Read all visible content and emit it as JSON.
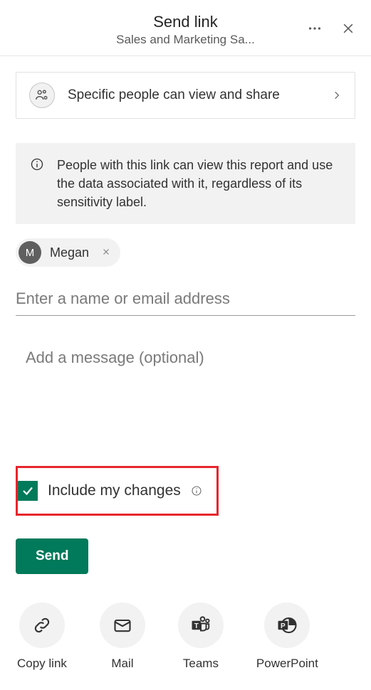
{
  "header": {
    "title": "Send link",
    "subtitle": "Sales and Marketing Sa..."
  },
  "permission": {
    "label": "Specific people can view and share"
  },
  "banner": {
    "text": "People with this link can view this report and use the data associated with it, regardless of its sensitivity label."
  },
  "recipients": [
    {
      "initial": "M",
      "name": "Megan"
    }
  ],
  "nameInput": {
    "placeholder": "Enter a name or email address",
    "value": ""
  },
  "messageInput": {
    "placeholder": "Add a message (optional)",
    "value": ""
  },
  "includeChanges": {
    "label": "Include my changes",
    "checked": true
  },
  "sendButton": {
    "label": "Send"
  },
  "shareTargets": [
    {
      "label": "Copy link",
      "icon": "link"
    },
    {
      "label": "Mail",
      "icon": "mail"
    },
    {
      "label": "Teams",
      "icon": "teams"
    },
    {
      "label": "PowerPoint",
      "icon": "powerpoint"
    }
  ]
}
